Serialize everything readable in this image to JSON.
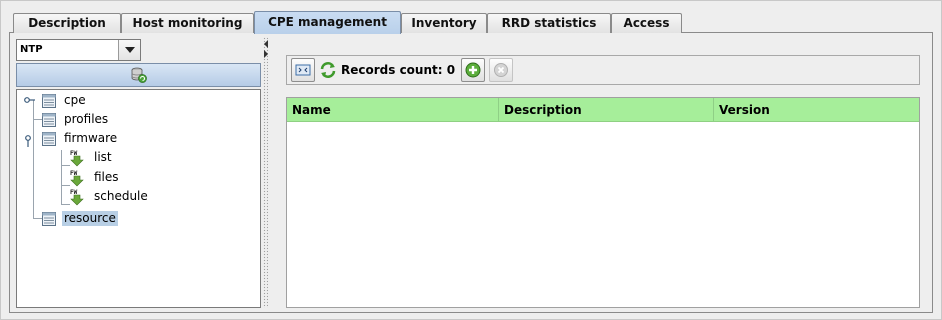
{
  "tabs": [
    {
      "label": "Description"
    },
    {
      "label": "Host monitoring"
    },
    {
      "label": "CPE management",
      "active": true
    },
    {
      "label": "Inventory"
    },
    {
      "label": "RRD statistics"
    },
    {
      "label": "Access"
    }
  ],
  "left_panel": {
    "combo": {
      "selected": "NTP"
    },
    "refresh_icon": "database-refresh-icon",
    "tree": [
      {
        "label": "cpe",
        "icon": "table-icon",
        "level": 0,
        "expandable": true
      },
      {
        "label": "profiles",
        "icon": "table-icon",
        "level": 0,
        "expandable": false
      },
      {
        "label": "firmware",
        "icon": "table-icon",
        "level": 0,
        "expandable": true,
        "expanded": true
      },
      {
        "label": "list",
        "icon": "fw-download-icon",
        "level": 1
      },
      {
        "label": "files",
        "icon": "fw-download-icon",
        "level": 1
      },
      {
        "label": "schedule",
        "icon": "fw-download-icon",
        "level": 1
      },
      {
        "label": "resource",
        "icon": "table-icon",
        "level": 0,
        "selected": true
      }
    ]
  },
  "toolbar": {
    "records_label": "Records count: 0",
    "buttons": [
      "fit-columns-icon",
      "refresh-icon",
      "add-icon",
      "delete-icon"
    ]
  },
  "grid": {
    "columns": [
      "Name",
      "Description",
      "Version"
    ],
    "header_color": "#a6ee9a",
    "rows": []
  },
  "colors": {
    "active_tab": "#c9dcf2",
    "selection": "#b8cfe5",
    "accent_green": "#5cae3c"
  }
}
